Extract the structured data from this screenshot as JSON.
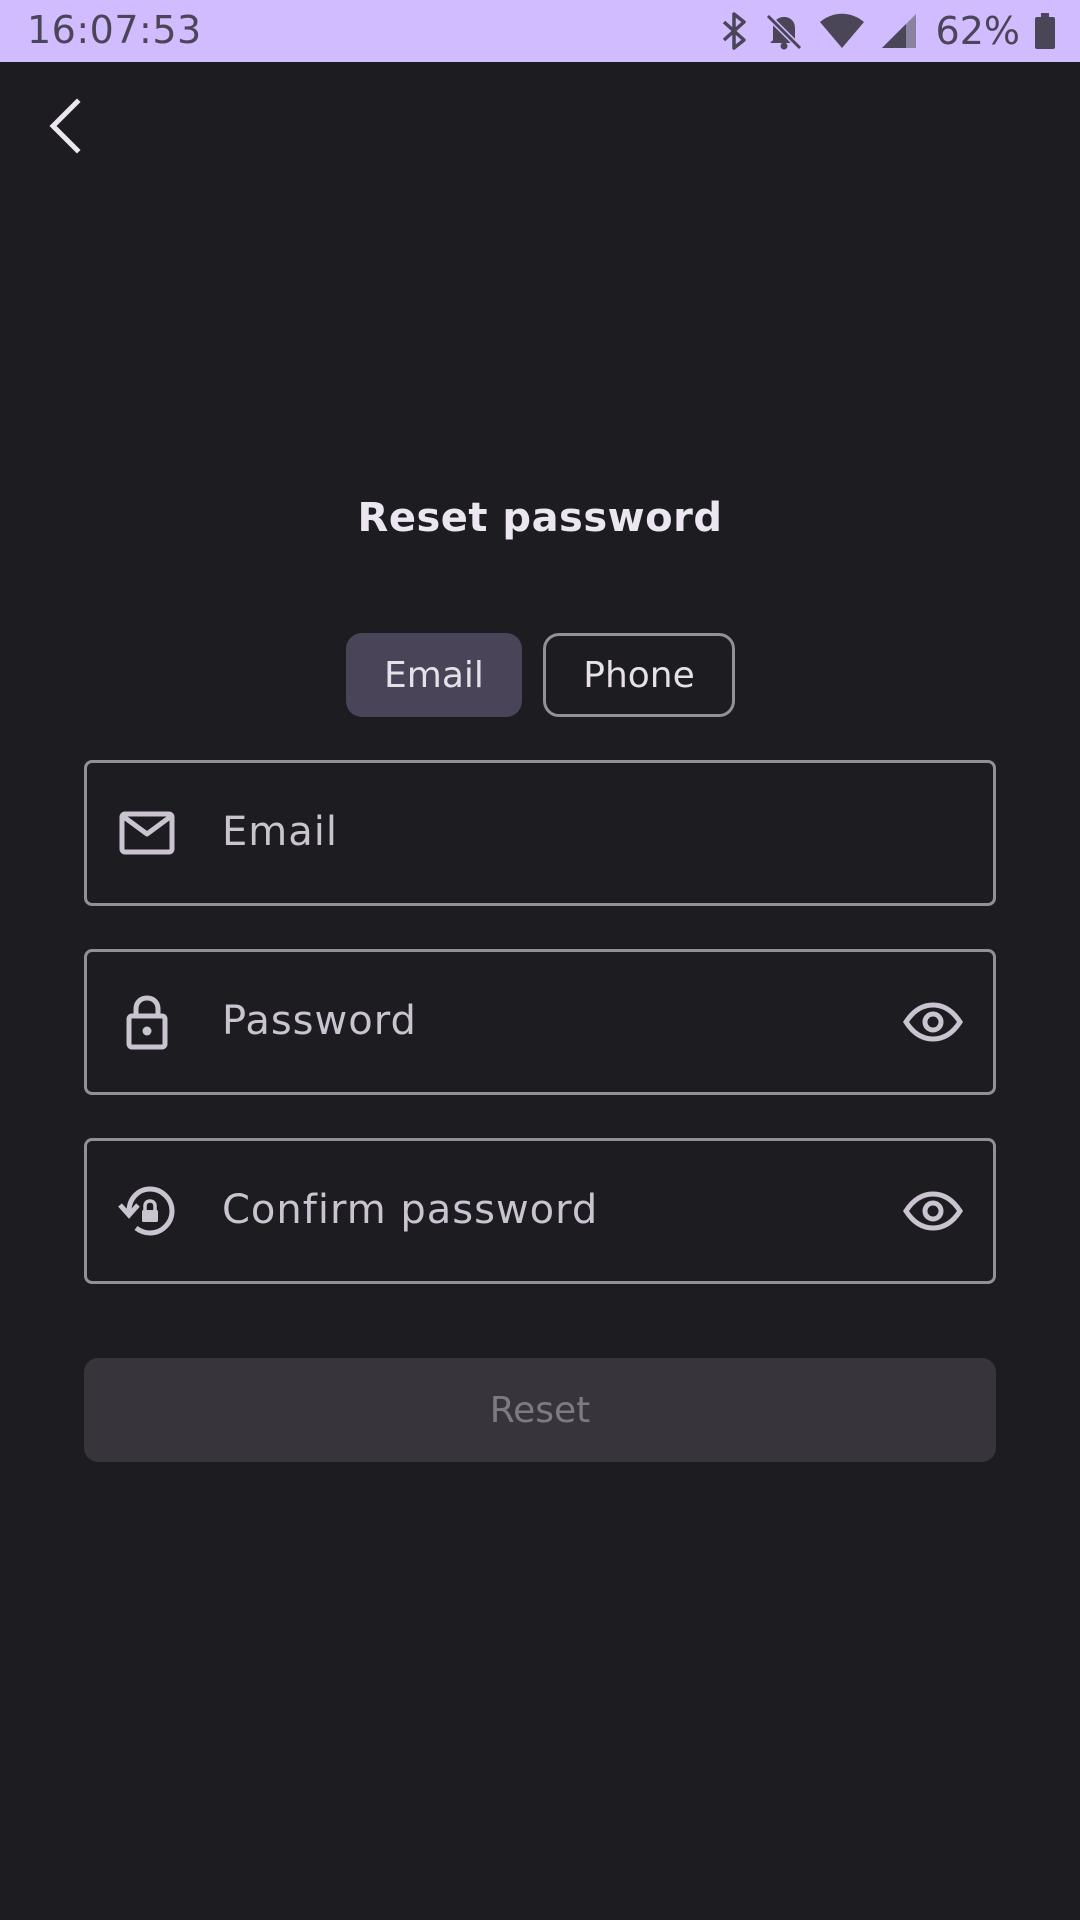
{
  "status_bar": {
    "time": "16:07:53",
    "battery_percent": "62%",
    "icons": [
      "bluetooth-icon",
      "bell-off-icon",
      "wifi-icon",
      "cellular-signal-icon",
      "battery-icon"
    ]
  },
  "header": {
    "back_icon": "chevron-left-icon"
  },
  "title": "Reset password",
  "segmented": {
    "selected": "Email",
    "options": [
      "Email",
      "Phone"
    ]
  },
  "fields": {
    "email": {
      "placeholder": "Email",
      "icon": "mail-icon"
    },
    "password": {
      "placeholder": "Password",
      "icon": "lock-icon",
      "trailing_icon": "eye-icon"
    },
    "confirm": {
      "placeholder": "Confirm password",
      "icon": "lock-reset-icon",
      "trailing_icon": "eye-icon"
    }
  },
  "actions": {
    "reset_label": "Reset"
  },
  "colors": {
    "background": "#1d1c21",
    "status_bar": "#d0bcff",
    "segment_selected": "#4a4458",
    "outline": "#938f99",
    "disabled_button": "#37353b"
  }
}
